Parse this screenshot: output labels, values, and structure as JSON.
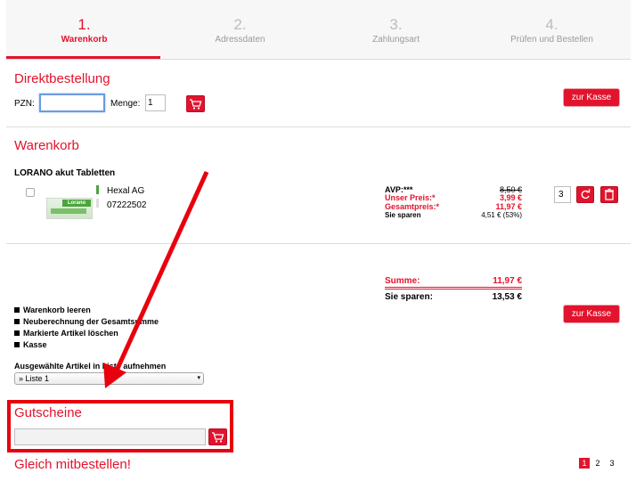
{
  "steps": [
    {
      "num": "1.",
      "label": "Warenkorb"
    },
    {
      "num": "2.",
      "label": "Adressdaten"
    },
    {
      "num": "3.",
      "label": "Zahlungsart"
    },
    {
      "num": "4.",
      "label": "Prüfen und Bestellen"
    }
  ],
  "direkt": {
    "title": "Direktbestellung",
    "pzn_label": "PZN:",
    "pzn_value": "",
    "menge_label": "Menge:",
    "menge_value": "1",
    "kasse_label": "zur Kasse"
  },
  "cart": {
    "title": "Warenkorb",
    "product": {
      "name": "LORANO akut Tabletten",
      "maker": "Hexal AG",
      "pzn": "07222502",
      "pack_brand": "Lorano",
      "avp_label": "AVP:***",
      "avp_value": "8,50 €",
      "unser_label": "Unser Preis:*",
      "unser_value": "3,99 €",
      "gesamt_label": "Gesamtpreis:*",
      "gesamt_value": "11,97 €",
      "sparen_label": "Sie sparen",
      "sparen_value": "4,51 € (53%)",
      "qty": "3"
    },
    "summe_label": "Summe:",
    "summe_value": "11,97 €",
    "sie_sparen_label": "Sie sparen:",
    "sie_sparen_value": "13,53 €",
    "kasse_label": "zur Kasse",
    "actions": [
      "Warenkorb leeren",
      "Neuberechnung der Gesamtsumme",
      "Markierte Artikel löschen",
      "Kasse"
    ],
    "list_label": "Ausgewählte Artikel in Liste aufnehmen",
    "list_selected": "» Liste 1"
  },
  "gutscheine": {
    "title": "Gutscheine",
    "value": ""
  },
  "mitbestellen": {
    "title": "Gleich mitbestellen!",
    "pages": [
      "1",
      "2",
      "3"
    ]
  },
  "colors": {
    "accent": "#e2132d",
    "highlight_border": "#e8000d"
  }
}
